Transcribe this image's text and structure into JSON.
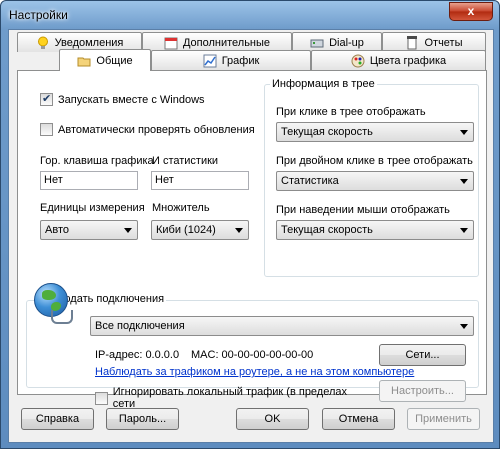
{
  "window": {
    "title": "Настройки",
    "close_glyph": "x"
  },
  "tabs_back": [
    "Уведомления",
    "Дополнительные",
    "Dial-up",
    "Отчеты"
  ],
  "tabs_front": [
    "Общие",
    "График",
    "Цвета графика"
  ],
  "general": {
    "run_with_windows": {
      "label": "Запускать вместе с Windows",
      "checked": true
    },
    "auto_update": {
      "label": "Автоматически проверять обновления",
      "checked": false
    },
    "hotkey_graph_label": "Гор. клавиша графика",
    "hotkey_stats_label": "И статистики",
    "hotkey_graph_value": "Нет",
    "hotkey_stats_value": "Нет",
    "units_label": "Единицы измерения",
    "units_value": "Авто",
    "multiplier_label": "Множитель",
    "multiplier_value": "Киби (1024)"
  },
  "tray": {
    "title": "Информация в трее",
    "click_label": "При клике в трее отображать",
    "click_value": "Текущая скорость",
    "dblclick_label": "При двойном клике в трее отображать",
    "dblclick_value": "Статистика",
    "hover_label": "При наведении мыши отображать",
    "hover_value": "Текущая скорость"
  },
  "connections": {
    "title": "Наблюдать подключения",
    "select_value": "Все подключения",
    "ip_text": "IP-адрес: 0.0.0.0",
    "mac_text": "MAC: 00-00-00-00-00-00",
    "networks_button": "Сети...",
    "router_link": "Наблюдать за трафиком на роутере, а не на этом компьютере",
    "ignore_local": {
      "label": "Игнорировать локальный трафик (в пределах сети",
      "checked": false
    },
    "configure_button": "Настроить..."
  },
  "footer": {
    "help": "Справка",
    "password": "Пароль...",
    "ok": "OK",
    "cancel": "Отмена",
    "apply": "Применить"
  }
}
